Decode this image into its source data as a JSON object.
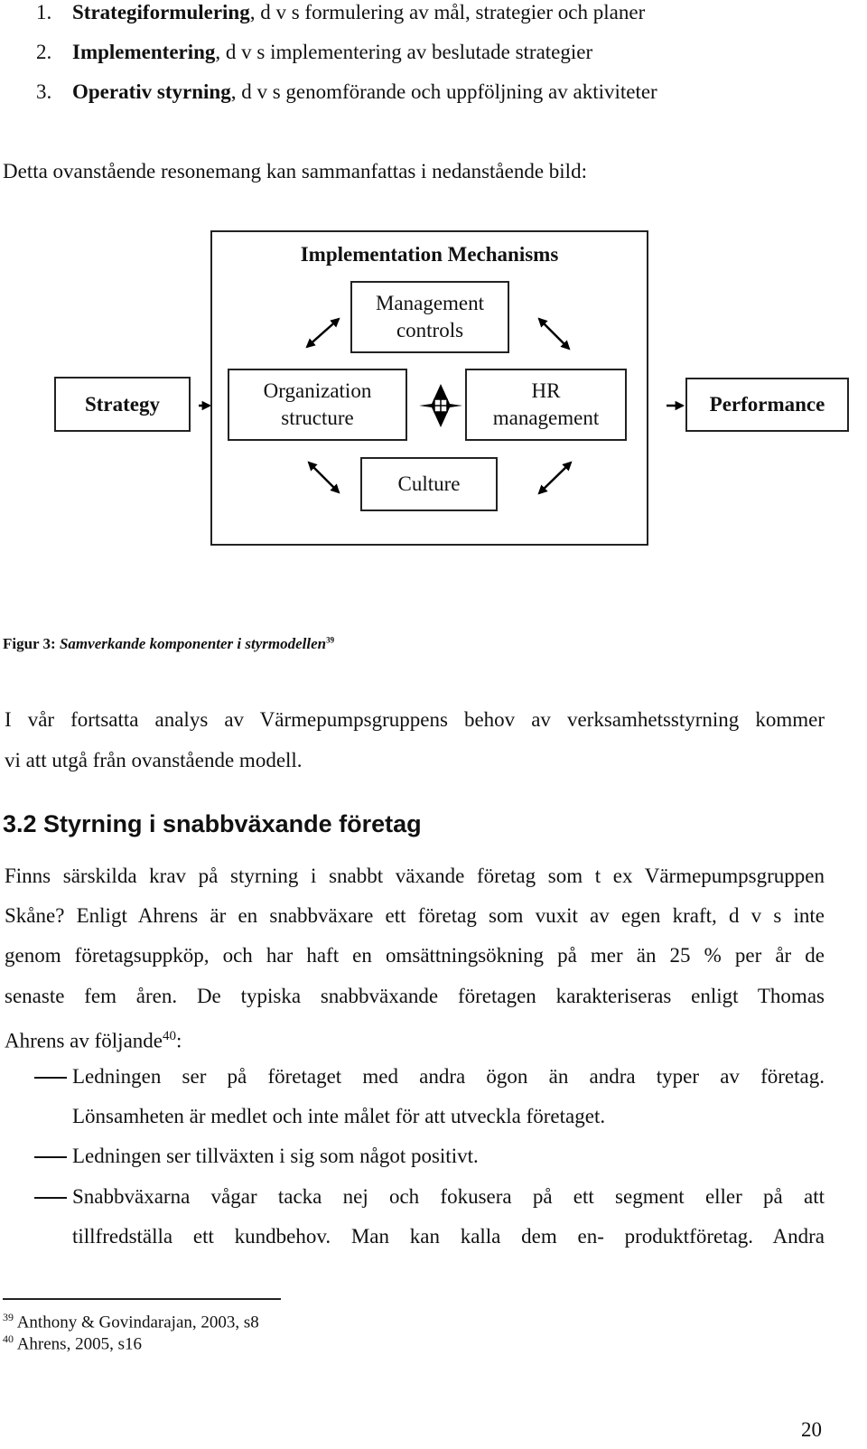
{
  "list": [
    {
      "num": "1.",
      "bold": "Strategiformulering",
      "rest": ", d v s formulering av mål, strategier och planer"
    },
    {
      "num": "2.",
      "bold": "Implementering",
      "rest": ", d v s implementering av beslutade strategier"
    },
    {
      "num": "3.",
      "bold": "Operativ styrning",
      "rest": ", d v s genomförande och uppföljning av aktiviteter"
    }
  ],
  "intro": "Detta ovanstående resonemang kan sammanfattas i nedanstående bild:",
  "diagram": {
    "outer_title": "Implementation Mechanisms",
    "strategy": "Strategy",
    "performance": "Performance",
    "management_controls": [
      "Management",
      "controls"
    ],
    "organization_structure": [
      "Organization",
      "structure"
    ],
    "hr_management": [
      "HR",
      "management"
    ],
    "culture": "Culture"
  },
  "caption": {
    "label": "Figur 3:",
    "title": "Samverkande komponenter i styrmodellen",
    "footnote_ref": "39"
  },
  "paragraph1": [
    "I vår fortsatta analys av Värmepumpsgruppens behov av verksamhetsstyrning kommer",
    "vi att utgå från ovanstående modell."
  ],
  "section_heading": "3.2 Styrning i snabbväxande företag",
  "paragraph2": [
    "Finns särskilda krav på styrning i snabbt växande företag som t ex Värmepumpsgruppen",
    "Skåne? Enligt Ahrens är en snabbväxare ett företag som vuxit av egen kraft, d v s inte",
    "genom företagsuppköp, och har haft en omsättningsökning på mer än 25 % per år de",
    "senaste fem åren. De typiska snabbväxande företagen karakteriseras enligt Thomas"
  ],
  "paragraph2_last": {
    "text": "Ahrens av följande",
    "sup": "40",
    "tail": ":"
  },
  "bullets": [
    [
      "Ledningen ser på företaget med andra ögon än andra typer av företag.",
      "Lönsamheten är medlet och inte målet för att utveckla företaget."
    ],
    [
      "Ledningen ser tillväxten i sig som något positivt."
    ],
    [
      "Snabbväxarna vågar tacka nej och fokusera på ett segment eller på att",
      "tillfredställa ett kundbehov. Man kan kalla dem en- produktföretag. Andra"
    ]
  ],
  "footnotes": [
    {
      "num": "39",
      "text": "Anthony & Govindarajan, 2003, s8"
    },
    {
      "num": "40",
      "text": "Ahrens, 2005, s16"
    }
  ],
  "page_number": "20"
}
